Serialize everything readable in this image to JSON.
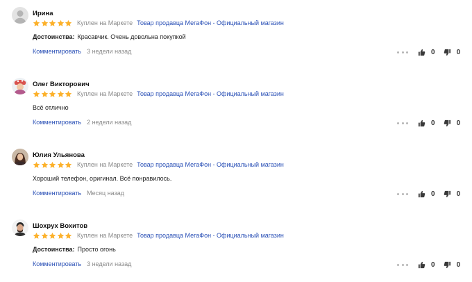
{
  "colors": {
    "star": "#fcb12b",
    "link": "#2a50b6",
    "muted": "#8a8a8a"
  },
  "icons": {
    "star": "star-icon",
    "more": "more-dots-icon",
    "like": "thumb-up-icon",
    "dislike": "thumb-down-icon"
  },
  "reviews": [
    {
      "author": "Ирина",
      "rating": 5,
      "purchased": "Куплен на Маркете",
      "seller": "Товар продавца МегаФон - Официальный магазин",
      "label": "Достоинства:",
      "text": "Красавчик. Очень довольна покупкой",
      "comment_label": "Комментировать",
      "time": "3 недели назад",
      "likes": "0",
      "dislikes": "0"
    },
    {
      "author": "Олег Викторович",
      "rating": 5,
      "purchased": "Куплен на Маркете",
      "seller": "Товар продавца МегаФон - Официальный магазин",
      "label": "",
      "text": "Всё отлично",
      "comment_label": "Комментировать",
      "time": "2 недели назад",
      "likes": "0",
      "dislikes": "0"
    },
    {
      "author": "Юлия Ульянова",
      "rating": 5,
      "purchased": "Куплен на Маркете",
      "seller": "Товар продавца МегаФон - Официальный магазин",
      "label": "",
      "text": "Хороший телефон, оригинал. Всё понравилось.",
      "comment_label": "Комментировать",
      "time": "Месяц назад",
      "likes": "0",
      "dislikes": "0"
    },
    {
      "author": "Шохрух Вохитов",
      "rating": 5,
      "purchased": "Куплен на Маркете",
      "seller": "Товар продавца МегаФон - Официальный магазин",
      "label": "Достоинства:",
      "text": "Просто огонь",
      "comment_label": "Комментировать",
      "time": "3 недели назад",
      "likes": "0",
      "dislikes": "0"
    }
  ]
}
